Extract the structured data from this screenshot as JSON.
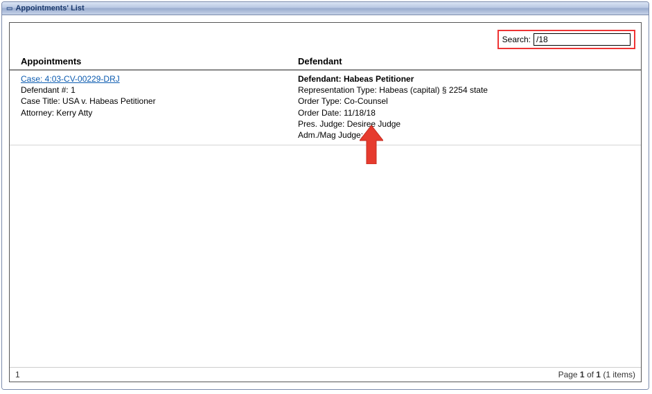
{
  "panel": {
    "title": "Appointments' List"
  },
  "search": {
    "label": "Search:",
    "value": "/18"
  },
  "columns": {
    "appointments": "Appointments",
    "defendant": "Defendant"
  },
  "rows": [
    {
      "case_link": "Case: 4:03-CV-00229-DRJ",
      "defendant_num_label": "Defendant #:",
      "defendant_num": "1",
      "case_title_label": "Case Title:",
      "case_title": "USA v. Habeas Petitioner",
      "attorney_label": "Attorney:",
      "attorney": "Kerry Atty",
      "defendant_label": "Defendant:",
      "defendant_name": "Habeas Petitioner",
      "rep_type_label": "Representation Type:",
      "rep_type": "Habeas (capital) § 2254 state",
      "order_type_label": "Order Type:",
      "order_type": "Co-Counsel",
      "order_date_label": "Order Date:",
      "order_date": "11/18/18",
      "pres_judge_label": "Pres. Judge:",
      "pres_judge": "Desiree Judge",
      "adm_judge_label": "Adm./Mag Judge:",
      "adm_judge": ""
    }
  ],
  "footer": {
    "left": "1",
    "page_prefix": "Page ",
    "page_current": "1",
    "page_mid": " of ",
    "page_total": "1",
    "items_suffix": " (1 items)"
  }
}
